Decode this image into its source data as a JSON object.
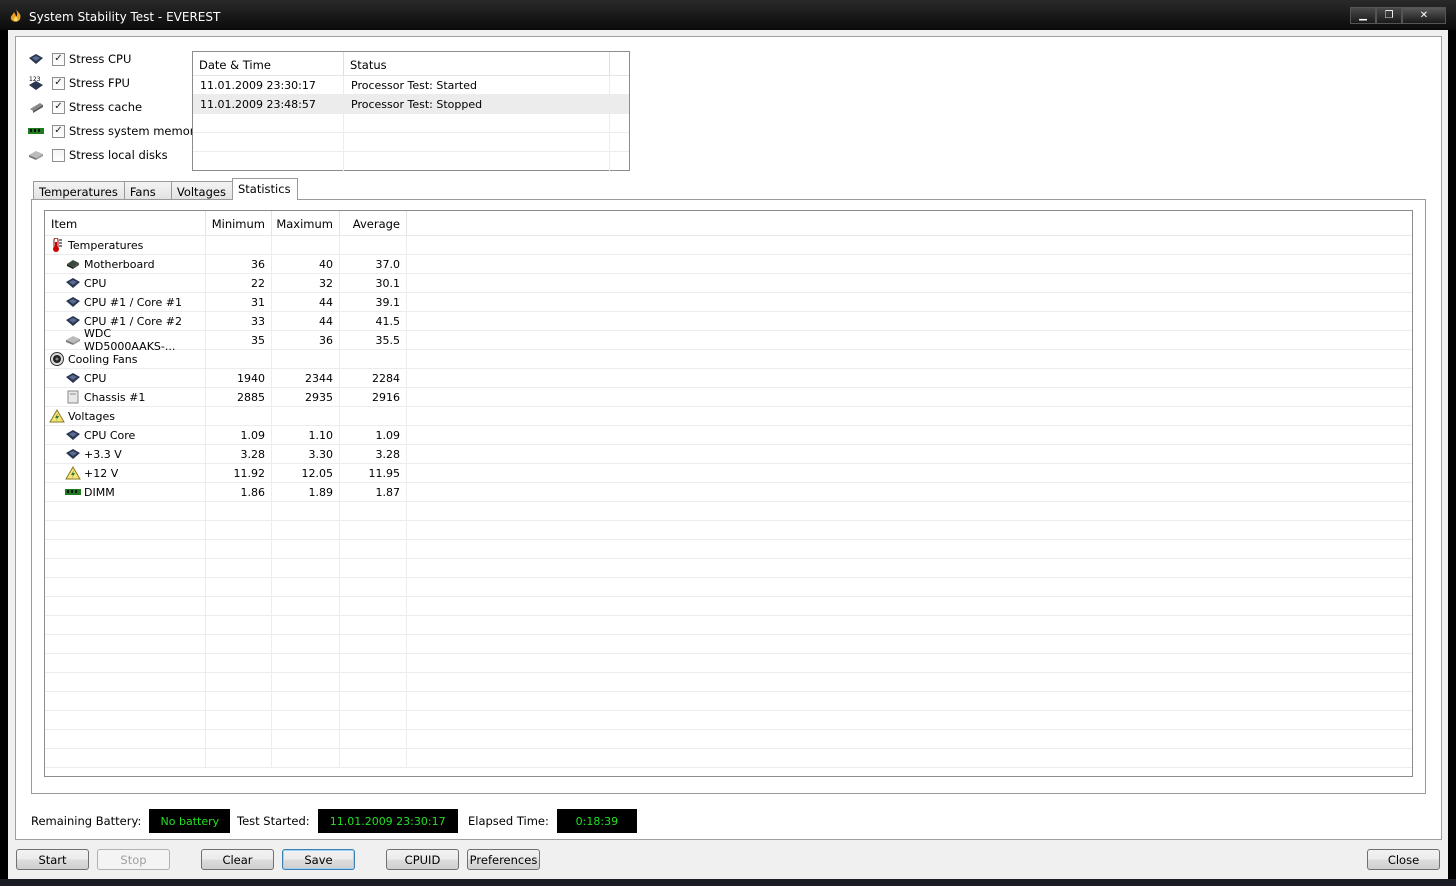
{
  "window": {
    "title": "System Stability Test - EVEREST",
    "min_icon": "minimize-icon",
    "max_icon": "restore-icon",
    "close_icon": "close-icon"
  },
  "stress_options": [
    {
      "label": "Stress CPU",
      "checked": true,
      "icon": "cpu-chip-icon"
    },
    {
      "label": "Stress FPU",
      "checked": true,
      "icon": "fpu-chip-icon"
    },
    {
      "label": "Stress cache",
      "checked": true,
      "icon": "cache-chip-icon"
    },
    {
      "label": "Stress system memory",
      "checked": true,
      "icon": "memory-module-icon"
    },
    {
      "label": "Stress local disks",
      "checked": false,
      "icon": "hard-disk-icon"
    }
  ],
  "log": {
    "headers": [
      "Date & Time",
      "Status"
    ],
    "rows": [
      [
        "11.01.2009 23:30:17",
        "Processor Test: Started"
      ],
      [
        "11.01.2009 23:48:57",
        "Processor Test: Stopped"
      ]
    ]
  },
  "tabs": [
    "Temperatures",
    "Fans",
    "Voltages",
    "Statistics"
  ],
  "active_tab": "Statistics",
  "stats": {
    "headers": [
      "Item",
      "Minimum",
      "Maximum",
      "Average"
    ],
    "rows": [
      {
        "type": "group",
        "item": "Temperatures",
        "icon": "thermometer-icon"
      },
      {
        "type": "sub",
        "item": "Motherboard",
        "icon": "motherboard-icon",
        "min": "36",
        "max": "40",
        "avg": "37.0"
      },
      {
        "type": "sub",
        "item": "CPU",
        "icon": "cpu-chip-icon",
        "min": "22",
        "max": "32",
        "avg": "30.1"
      },
      {
        "type": "sub",
        "item": "CPU #1 / Core #1",
        "icon": "cpu-chip-icon",
        "min": "31",
        "max": "44",
        "avg": "39.1"
      },
      {
        "type": "sub",
        "item": "CPU #1 / Core #2",
        "icon": "cpu-chip-icon",
        "min": "33",
        "max": "44",
        "avg": "41.5"
      },
      {
        "type": "sub",
        "item": "WDC WD5000AAKS-...",
        "icon": "hard-disk-icon",
        "min": "35",
        "max": "36",
        "avg": "35.5"
      },
      {
        "type": "group",
        "item": "Cooling Fans",
        "icon": "fan-icon"
      },
      {
        "type": "sub",
        "item": "CPU",
        "icon": "cpu-chip-icon",
        "min": "1940",
        "max": "2344",
        "avg": "2284"
      },
      {
        "type": "sub",
        "item": "Chassis #1",
        "icon": "chassis-icon",
        "min": "2885",
        "max": "2935",
        "avg": "2916"
      },
      {
        "type": "group",
        "item": "Voltages",
        "icon": "voltage-warning-icon"
      },
      {
        "type": "sub",
        "item": "CPU Core",
        "icon": "cpu-chip-icon",
        "min": "1.09",
        "max": "1.10",
        "avg": "1.09"
      },
      {
        "type": "sub",
        "item": "+3.3 V",
        "icon": "cpu-chip-icon",
        "min": "3.28",
        "max": "3.30",
        "avg": "3.28"
      },
      {
        "type": "sub",
        "item": "+12 V",
        "icon": "voltage-warning-icon",
        "min": "11.92",
        "max": "12.05",
        "avg": "11.95"
      },
      {
        "type": "sub",
        "item": "DIMM",
        "icon": "memory-module-icon",
        "min": "1.86",
        "max": "1.89",
        "avg": "1.87"
      }
    ]
  },
  "status": {
    "battery_label": "Remaining Battery:",
    "battery_value": "No battery",
    "started_label": "Test Started:",
    "started_value": "11.01.2009 23:30:17",
    "elapsed_label": "Elapsed Time:",
    "elapsed_value": "0:18:39"
  },
  "buttons": {
    "start": "Start",
    "stop": "Stop",
    "clear": "Clear",
    "save": "Save",
    "cpuid": "CPUID",
    "preferences": "Preferences",
    "close": "Close"
  },
  "colors": {
    "status_text": "#22e022",
    "status_bg": "#000000",
    "titlebar": "#111111"
  }
}
